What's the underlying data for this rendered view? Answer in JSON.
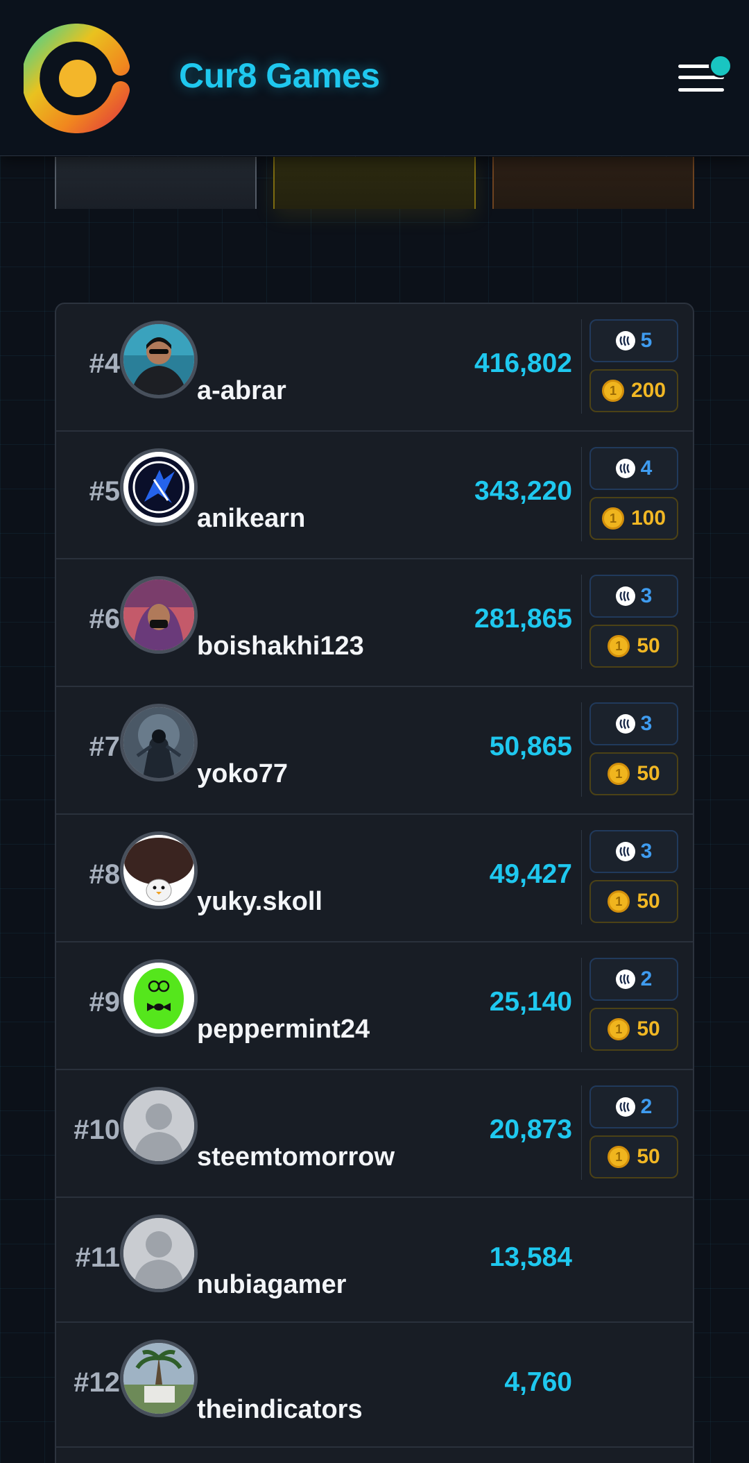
{
  "header": {
    "brand": "Cur8 Games",
    "accent_color": "#1fc8ef",
    "menu_icon": "hamburger-menu-icon"
  },
  "leaderboard": {
    "rows": [
      {
        "rank": "#4",
        "username": "a-abrar",
        "score": "416,802",
        "steem_reward": "5",
        "coin_reward": "200",
        "avatar": "user-photo-sunglasses"
      },
      {
        "rank": "#5",
        "username": "anikearn",
        "score": "343,220",
        "steem_reward": "4",
        "coin_reward": "100",
        "avatar": "blue-logo-avatar"
      },
      {
        "rank": "#6",
        "username": "boishakhi123",
        "score": "281,865",
        "steem_reward": "3",
        "coin_reward": "50",
        "avatar": "user-photo-hijab"
      },
      {
        "rank": "#7",
        "username": "yoko77",
        "score": "50,865",
        "steem_reward": "3",
        "coin_reward": "50",
        "avatar": "dark-warrior-avatar"
      },
      {
        "rank": "#8",
        "username": "yuky.skoll",
        "score": "49,427",
        "steem_reward": "3",
        "coin_reward": "50",
        "avatar": "penguin-avatar"
      },
      {
        "rank": "#9",
        "username": "peppermint24",
        "score": "25,140",
        "steem_reward": "2",
        "coin_reward": "50",
        "avatar": "green-egg-avatar"
      },
      {
        "rank": "#10",
        "username": "steemtomorrow",
        "score": "20,873",
        "steem_reward": "2",
        "coin_reward": "50",
        "avatar": "default-avatar"
      },
      {
        "rank": "#11",
        "username": "nubiagamer",
        "score": "13,584",
        "steem_reward": "",
        "coin_reward": "",
        "avatar": "default-avatar"
      },
      {
        "rank": "#12",
        "username": "theindicators",
        "score": "4,760",
        "steem_reward": "",
        "coin_reward": "",
        "avatar": "palm-tree-photo"
      }
    ]
  }
}
